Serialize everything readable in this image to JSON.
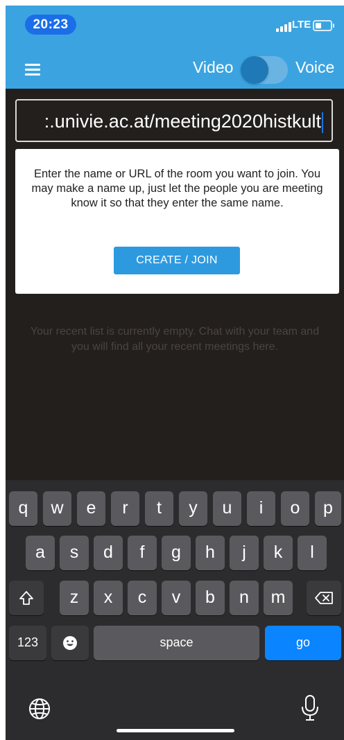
{
  "status_bar": {
    "time": "20:23",
    "network": "LTE",
    "icons": [
      "signal-icon",
      "battery-icon"
    ]
  },
  "header": {
    "menu_icon": "hamburger-menu-icon",
    "video_label": "Video",
    "voice_label": "Voice",
    "toggle_state": "video"
  },
  "room_input": {
    "value": ":.univie.ac.at/meeting2020histkult"
  },
  "hint": {
    "text": "Enter the name or URL of the room you want to join. You may make a name up, just let the people you are meeting know it so that they enter the same name.",
    "button_label": "CREATE / JOIN"
  },
  "recent": {
    "empty_text": "Your recent list is currently empty. Chat with your team and you will find all your recent meetings here."
  },
  "keyboard": {
    "row1": [
      "q",
      "w",
      "e",
      "r",
      "t",
      "y",
      "u",
      "i",
      "o",
      "p"
    ],
    "row2": [
      "a",
      "s",
      "d",
      "f",
      "g",
      "h",
      "j",
      "k",
      "l"
    ],
    "row3": [
      "z",
      "x",
      "c",
      "v",
      "b",
      "n",
      "m"
    ],
    "numbers_label": "123",
    "space_label": "space",
    "go_label": "go",
    "icons": [
      "shift-icon",
      "backspace-icon",
      "emoji-icon",
      "globe-icon",
      "microphone-icon"
    ]
  },
  "colors": {
    "header": "#3ba4e0",
    "time_pill": "#1b6ee8",
    "join_button": "#2d9ae0",
    "go_key": "#0a84ff"
  }
}
